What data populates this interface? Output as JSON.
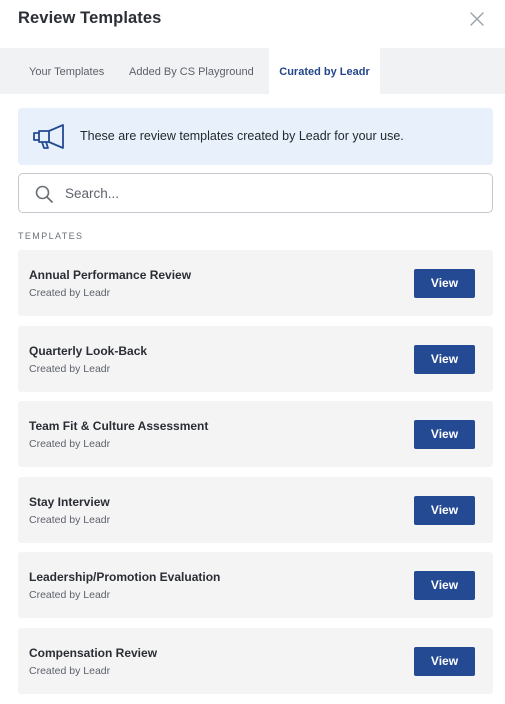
{
  "dialog": {
    "title": "Review Templates",
    "close_icon": "close-icon"
  },
  "tabs": [
    {
      "label": "Your Templates",
      "active": false
    },
    {
      "label": "Added By CS Playground",
      "active": false
    },
    {
      "label": "Curated by Leadr",
      "active": true
    }
  ],
  "banner": {
    "icon": "megaphone-icon",
    "text": "These are review templates created by Leadr for your use."
  },
  "search": {
    "icon": "search-icon",
    "placeholder": "Search...",
    "value": ""
  },
  "section_label": "TEMPLATES",
  "templates": [
    {
      "name": "Annual Performance Review",
      "subtitle": "Created by Leadr",
      "action": "View"
    },
    {
      "name": "Quarterly Look-Back",
      "subtitle": "Created by Leadr",
      "action": "View"
    },
    {
      "name": "Team Fit & Culture Assessment",
      "subtitle": "Created by Leadr",
      "action": "View"
    },
    {
      "name": "Stay Interview",
      "subtitle": "Created by Leadr",
      "action": "View"
    },
    {
      "name": "Leadership/Promotion Evaluation",
      "subtitle": "Created by Leadr",
      "action": "View"
    },
    {
      "name": "Compensation Review",
      "subtitle": "Created by Leadr",
      "action": "View"
    }
  ],
  "colors": {
    "accent": "#244a93",
    "active_tab_text": "#25468c",
    "banner_bg": "#e8f1fb",
    "card_bg": "#f4f4f5",
    "tabbar_bg": "#f1f2f4"
  }
}
